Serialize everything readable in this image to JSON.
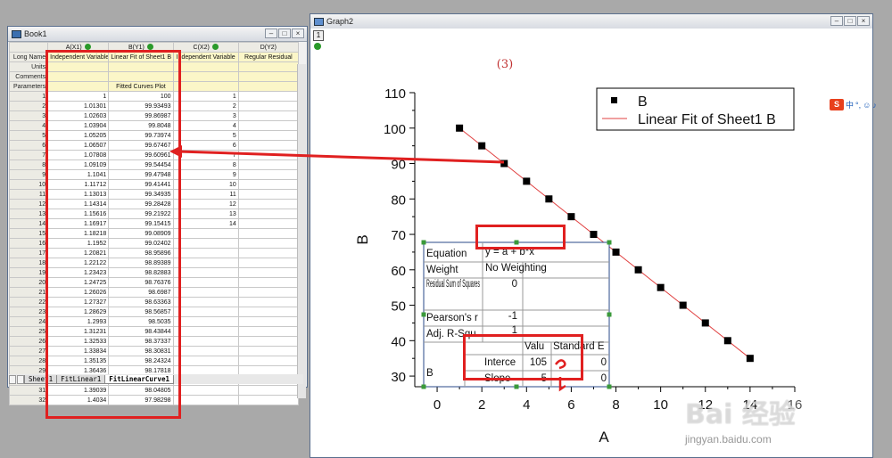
{
  "book": {
    "title": "Book1",
    "columns": [
      {
        "name": "A(X1)"
      },
      {
        "name": "B(Y1)"
      },
      {
        "name": "C(X2)"
      },
      {
        "name": "D(Y2)"
      }
    ],
    "meta_rows": [
      {
        "label": "Long Name",
        "values": [
          "Independent Variable",
          "Linear Fit of Sheet1 B",
          "Independent Variable",
          "Regular Residual"
        ]
      },
      {
        "label": "Units",
        "values": [
          "",
          "",
          "",
          ""
        ]
      },
      {
        "label": "Comments",
        "values": [
          "",
          "",
          "",
          ""
        ]
      },
      {
        "label": "Parameters",
        "values": [
          "",
          "Fitted Curves Plot",
          "",
          ""
        ]
      }
    ],
    "rows": [
      {
        "n": "1",
        "a": "1",
        "b": "100",
        "c": "1"
      },
      {
        "n": "2",
        "a": "1.01301",
        "b": "99.93493",
        "c": "2"
      },
      {
        "n": "3",
        "a": "1.02603",
        "b": "99.86987",
        "c": "3"
      },
      {
        "n": "4",
        "a": "1.03904",
        "b": "99.8048",
        "c": "4"
      },
      {
        "n": "5",
        "a": "1.05205",
        "b": "99.73974",
        "c": "5"
      },
      {
        "n": "6",
        "a": "1.06507",
        "b": "99.67467",
        "c": "6"
      },
      {
        "n": "7",
        "a": "1.07808",
        "b": "99.60961",
        "c": "7"
      },
      {
        "n": "8",
        "a": "1.09109",
        "b": "99.54454",
        "c": "8"
      },
      {
        "n": "9",
        "a": "1.1041",
        "b": "99.47948",
        "c": "9"
      },
      {
        "n": "10",
        "a": "1.11712",
        "b": "99.41441",
        "c": "10"
      },
      {
        "n": "11",
        "a": "1.13013",
        "b": "99.34935",
        "c": "11"
      },
      {
        "n": "12",
        "a": "1.14314",
        "b": "99.28428",
        "c": "12"
      },
      {
        "n": "13",
        "a": "1.15616",
        "b": "99.21922",
        "c": "13"
      },
      {
        "n": "14",
        "a": "1.16917",
        "b": "99.15415",
        "c": "14"
      },
      {
        "n": "15",
        "a": "1.18218",
        "b": "99.08909",
        "c": ""
      },
      {
        "n": "16",
        "a": "1.1952",
        "b": "99.02402",
        "c": ""
      },
      {
        "n": "17",
        "a": "1.20821",
        "b": "98.95896",
        "c": ""
      },
      {
        "n": "18",
        "a": "1.22122",
        "b": "98.89389",
        "c": ""
      },
      {
        "n": "19",
        "a": "1.23423",
        "b": "98.82883",
        "c": ""
      },
      {
        "n": "20",
        "a": "1.24725",
        "b": "98.76376",
        "c": ""
      },
      {
        "n": "21",
        "a": "1.26026",
        "b": "98.6987",
        "c": ""
      },
      {
        "n": "22",
        "a": "1.27327",
        "b": "98.63363",
        "c": ""
      },
      {
        "n": "23",
        "a": "1.28629",
        "b": "98.56857",
        "c": ""
      },
      {
        "n": "24",
        "a": "1.2993",
        "b": "98.5035",
        "c": ""
      },
      {
        "n": "25",
        "a": "1.31231",
        "b": "98.43844",
        "c": ""
      },
      {
        "n": "26",
        "a": "1.32533",
        "b": "98.37337",
        "c": ""
      },
      {
        "n": "27",
        "a": "1.33834",
        "b": "98.30831",
        "c": ""
      },
      {
        "n": "28",
        "a": "1.35135",
        "b": "98.24324",
        "c": ""
      },
      {
        "n": "29",
        "a": "1.36436",
        "b": "98.17818",
        "c": ""
      },
      {
        "n": "30",
        "a": "1.37738",
        "b": "98.11311",
        "c": ""
      },
      {
        "n": "31",
        "a": "1.39039",
        "b": "98.04805",
        "c": ""
      },
      {
        "n": "32",
        "a": "1.4034",
        "b": "97.98298",
        "c": ""
      }
    ],
    "sheet_tabs": [
      "Sheet1",
      "FitLinear1",
      "FitLinearCurve1"
    ],
    "active_tab": "FitLinearCurve1"
  },
  "graph": {
    "title": "Graph2",
    "layer_label": "1",
    "annotation": "(3)"
  },
  "chart_data": {
    "type": "scatter",
    "xlabel": "A",
    "ylabel": "B",
    "xlim": [
      -1,
      16
    ],
    "ylim": [
      27,
      110
    ],
    "x_ticks": [
      "0",
      "2",
      "4",
      "6",
      "8",
      "10",
      "12",
      "14",
      "16"
    ],
    "y_ticks": [
      "30",
      "40",
      "50",
      "60",
      "70",
      "80",
      "90",
      "100",
      "110"
    ],
    "series": [
      {
        "name": "B",
        "marker": "square",
        "x": [
          1,
          2,
          3,
          4,
          5,
          6,
          7,
          8,
          9,
          10,
          11,
          12,
          13,
          14
        ],
        "y": [
          100,
          95,
          90,
          85,
          80,
          75,
          70,
          65,
          60,
          55,
          50,
          45,
          40,
          35
        ]
      },
      {
        "name": "Linear Fit of Sheet1 B",
        "line": "solid",
        "color": "#e04040",
        "x": [
          1,
          14
        ],
        "y": [
          100,
          35
        ]
      }
    ],
    "legend_position": "top-right",
    "fit_table": {
      "equation_label": "Equation",
      "equation": "y = a + b*x",
      "weight_label": "Weight",
      "weight": "No Weighting",
      "rss_label": "Residual Sum of Squares",
      "rss": "0",
      "pearson_label": "Pearson's r",
      "pearson": "-1",
      "adjr_label": "Adj. R-Squ",
      "adjr": "1",
      "value_header": "Valu",
      "se_header": "Standard E",
      "group": "B",
      "intercept_label": "Interce",
      "intercept": "105",
      "intercept_se": "0",
      "slope_label": "Slope",
      "slope": "-5",
      "slope_se": "0"
    }
  },
  "toolbar_right": {
    "brand": "S",
    "text": "中"
  },
  "watermark": {
    "big": "Bai 经验",
    "small": "jingyan.baidu.com"
  },
  "colors": {
    "highlight": "#e02020",
    "fit_line": "#e04040",
    "marker": "#000000",
    "table_border": "#2a4a8a"
  }
}
